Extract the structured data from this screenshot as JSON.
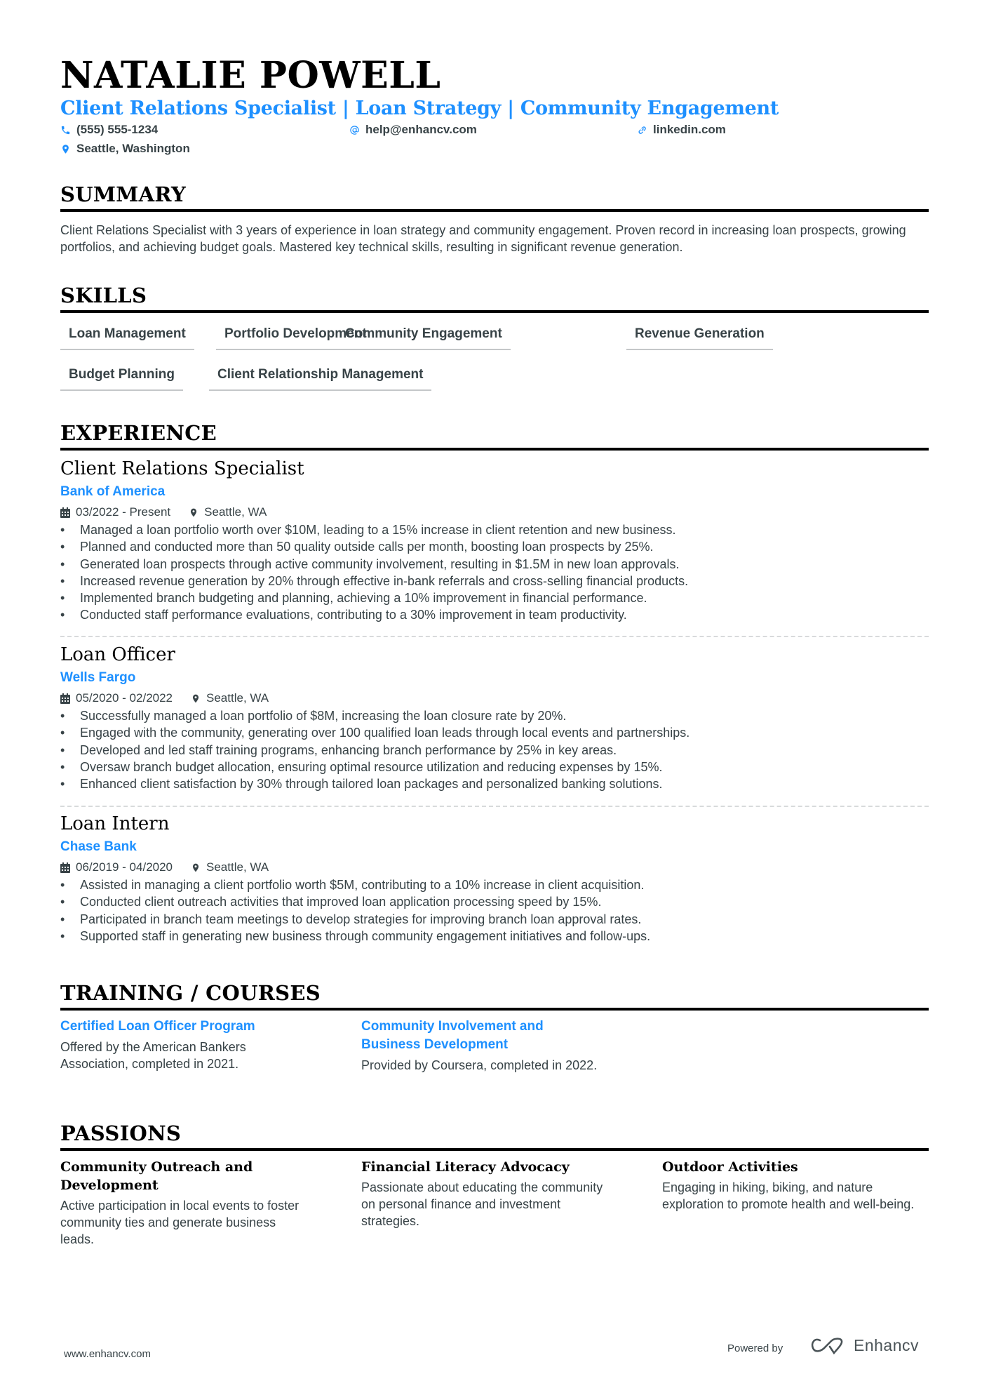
{
  "header": {
    "name": "NATALIE POWELL",
    "title": "Client Relations Specialist | Loan Strategy | Community Engagement",
    "contacts": [
      {
        "icon": "phone-icon",
        "value": "(555) 555-1234"
      },
      {
        "icon": "at-icon",
        "value": "help@enhancv.com"
      },
      {
        "icon": "link-icon",
        "value": "linkedin.com"
      },
      {
        "icon": "location-pin-icon",
        "value": "Seattle, Washington"
      }
    ]
  },
  "summary": {
    "heading": "SUMMARY",
    "text": "Client Relations Specialist with 3 years of experience in loan strategy and community engagement. Proven record in increasing loan prospects, growing portfolios, and achieving budget goals. Mastered key technical skills, resulting in significant revenue generation."
  },
  "skills": {
    "heading": "SKILLS",
    "items": [
      "Loan Management",
      "Portfolio Development",
      "Community Engagement",
      "Revenue Generation",
      "Budget Planning",
      "Client Relationship Management"
    ]
  },
  "experience": {
    "heading": "EXPERIENCE",
    "jobs": [
      {
        "title": "Client Relations Specialist",
        "company": "Bank of America",
        "dates": "03/2022 - Present",
        "location": "Seattle, WA",
        "bullets": [
          "Managed a loan portfolio worth over $10M, leading to a 15% increase in client retention and new business.",
          "Planned and conducted more than 50 quality outside calls per month, boosting loan prospects by 25%.",
          "Generated loan prospects through active community involvement, resulting in $1.5M in new loan approvals.",
          "Increased revenue generation by 20% through effective in-bank referrals and cross-selling financial products.",
          "Implemented branch budgeting and planning, achieving a 10% improvement in financial performance.",
          "Conducted staff performance evaluations, contributing to a 30% improvement in team productivity."
        ]
      },
      {
        "title": "Loan Officer",
        "company": "Wells Fargo",
        "dates": "05/2020 - 02/2022",
        "location": "Seattle, WA",
        "bullets": [
          "Successfully managed a loan portfolio of $8M, increasing the loan closure rate by 20%.",
          "Engaged with the community, generating over 100 qualified loan leads through local events and partnerships.",
          "Developed and led staff training programs, enhancing branch performance by 25% in key areas.",
          "Oversaw branch budget allocation, ensuring optimal resource utilization and reducing expenses by 15%.",
          "Enhanced client satisfaction by 30% through tailored loan packages and personalized banking solutions."
        ]
      },
      {
        "title": "Loan Intern",
        "company": "Chase Bank",
        "dates": "06/2019 - 04/2020",
        "location": "Seattle, WA",
        "bullets": [
          "Assisted in managing a client portfolio worth $5M, contributing to a 10% increase in client acquisition.",
          "Conducted client outreach activities that improved loan application processing speed by 15%.",
          "Participated in branch team meetings to develop strategies for improving branch loan approval rates.",
          "Supported staff in generating new business through community engagement initiatives and follow-ups."
        ]
      }
    ]
  },
  "training": {
    "heading": "TRAINING / COURSES",
    "items": [
      {
        "title": "Certified Loan Officer Program",
        "description": "Offered by the American Bankers Association, completed in 2021."
      },
      {
        "title": "Community Involvement and Business Development",
        "description": "Provided by Coursera, completed in 2022."
      }
    ]
  },
  "passions": {
    "heading": "PASSIONS",
    "items": [
      {
        "title": "Community Outreach and Development",
        "description": "Active participation in local events to foster community ties and generate business leads."
      },
      {
        "title": "Financial Literacy Advocacy",
        "description": "Passionate about educating the community on personal finance and investment strategies."
      },
      {
        "title": "Outdoor Activities",
        "description": "Engaging in hiking, biking, and nature exploration to promote health and well-being."
      }
    ]
  },
  "footer": {
    "url": "www.enhancv.com",
    "powered_by": "Powered by",
    "brand": "Enhancv"
  },
  "colors": {
    "accent": "#1e90ff",
    "text": "#384347",
    "heading": "#000000"
  }
}
